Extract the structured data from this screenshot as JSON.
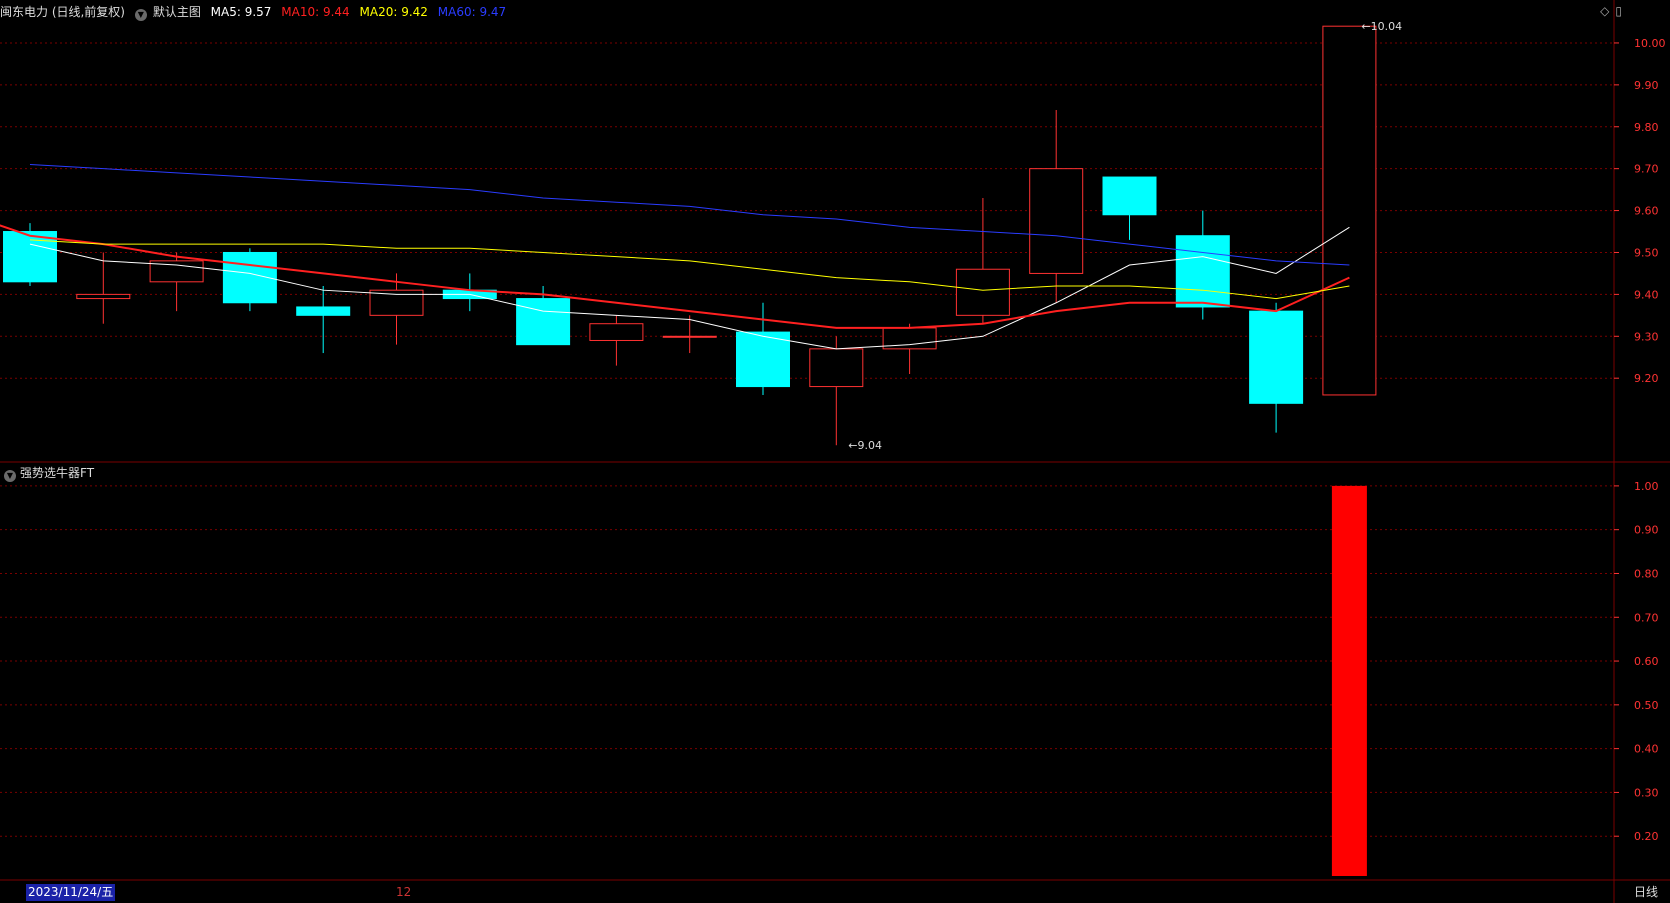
{
  "header": {
    "stock_title": "闽东电力 (日线,前复权)",
    "main_chart_name": "默认主图",
    "ma5": {
      "label": "MA5: 9.57",
      "color": "#ffffff"
    },
    "ma10": {
      "label": "MA10: 9.44",
      "color": "#ff2020"
    },
    "ma20": {
      "label": "MA20: 9.42",
      "color": "#ffff00"
    },
    "ma60": {
      "label": "MA60: 9.47",
      "color": "#2a3cff"
    }
  },
  "indicator": {
    "name": "强势选牛器FT"
  },
  "footer": {
    "date": "2023/11/24/五",
    "month_marker": "12",
    "period": "日线"
  },
  "colors": {
    "up": "#ff3232",
    "down": "#00ffff",
    "grid": "#7a0000",
    "axis_text": "#ff3333",
    "bar": "#ff0000"
  },
  "chart_data": [
    {
      "type": "candlestick",
      "ylim": [
        9.0,
        10.05
      ],
      "y_ticks": [
        "10.00",
        "9.90",
        "9.80",
        "9.70",
        "9.60",
        "9.50",
        "9.40",
        "9.30",
        "9.20"
      ],
      "y_tick_values": [
        10.0,
        9.9,
        9.8,
        9.7,
        9.6,
        9.5,
        9.4,
        9.3,
        9.2
      ],
      "candles": [
        {
          "o": 9.55,
          "h": 9.57,
          "l": 9.42,
          "c": 9.43
        },
        {
          "o": 9.39,
          "h": 9.5,
          "l": 9.33,
          "c": 9.4
        },
        {
          "o": 9.43,
          "h": 9.5,
          "l": 9.36,
          "c": 9.48
        },
        {
          "o": 9.5,
          "h": 9.51,
          "l": 9.36,
          "c": 9.38
        },
        {
          "o": 9.37,
          "h": 9.42,
          "l": 9.26,
          "c": 9.35
        },
        {
          "o": 9.35,
          "h": 9.45,
          "l": 9.28,
          "c": 9.41
        },
        {
          "o": 9.41,
          "h": 9.45,
          "l": 9.36,
          "c": 9.39
        },
        {
          "o": 9.39,
          "h": 9.42,
          "l": 9.28,
          "c": 9.28
        },
        {
          "o": 9.29,
          "h": 9.35,
          "l": 9.23,
          "c": 9.33
        },
        {
          "o": 9.3,
          "h": 9.35,
          "l": 9.26,
          "c": 9.3
        },
        {
          "o": 9.31,
          "h": 9.38,
          "l": 9.16,
          "c": 9.18
        },
        {
          "o": 9.18,
          "h": 9.3,
          "l": 9.04,
          "c": 9.27
        },
        {
          "o": 9.27,
          "h": 9.33,
          "l": 9.21,
          "c": 9.32
        },
        {
          "o": 9.35,
          "h": 9.63,
          "l": 9.33,
          "c": 9.46
        },
        {
          "o": 9.45,
          "h": 9.84,
          "l": 9.38,
          "c": 9.7
        },
        {
          "o": 9.68,
          "h": 9.68,
          "l": 9.53,
          "c": 9.59
        },
        {
          "o": 9.54,
          "h": 9.6,
          "l": 9.34,
          "c": 9.37
        },
        {
          "o": 9.36,
          "h": 9.38,
          "l": 9.07,
          "c": 9.14
        },
        {
          "o": 9.16,
          "h": 10.04,
          "l": 9.16,
          "c": 10.04
        }
      ],
      "ma_series": [
        {
          "name": "MA5",
          "color": "#ffffff",
          "width": 1,
          "values": [
            9.52,
            9.48,
            9.47,
            9.45,
            9.41,
            9.4,
            9.4,
            9.36,
            9.35,
            9.34,
            9.3,
            9.27,
            9.28,
            9.3,
            9.38,
            9.47,
            9.49,
            9.45,
            9.56
          ]
        },
        {
          "name": "MA10",
          "color": "#ff2020",
          "width": 2,
          "values": [
            9.57,
            9.54,
            9.52,
            9.49,
            9.47,
            9.45,
            9.43,
            9.41,
            9.4,
            9.38,
            9.36,
            9.34,
            9.32,
            9.32,
            9.33,
            9.36,
            9.38,
            9.38,
            9.36,
            9.44
          ]
        },
        {
          "name": "MA20",
          "color": "#ffff00",
          "width": 1,
          "values": [
            9.53,
            9.52,
            9.52,
            9.52,
            9.52,
            9.51,
            9.51,
            9.5,
            9.49,
            9.48,
            9.46,
            9.44,
            9.43,
            9.41,
            9.42,
            9.42,
            9.41,
            9.39,
            9.42
          ]
        },
        {
          "name": "MA60",
          "color": "#2a3cff",
          "width": 1,
          "values": [
            9.71,
            9.7,
            9.69,
            9.68,
            9.67,
            9.66,
            9.65,
            9.63,
            9.62,
            9.61,
            9.59,
            9.58,
            9.56,
            9.55,
            9.54,
            9.52,
            9.5,
            9.48,
            9.47
          ]
        }
      ],
      "annotations": [
        {
          "label": "10.04",
          "index": 18,
          "value": 10.04
        },
        {
          "label": "9.04",
          "index": 11,
          "value": 9.04
        }
      ]
    },
    {
      "type": "bar",
      "ylim": [
        0.1,
        1.05
      ],
      "y_ticks": [
        "1.00",
        "0.90",
        "0.80",
        "0.70",
        "0.60",
        "0.50",
        "0.40",
        "0.30",
        "0.20"
      ],
      "y_tick_values": [
        1.0,
        0.9,
        0.8,
        0.7,
        0.6,
        0.5,
        0.4,
        0.3,
        0.2
      ],
      "values": [
        0,
        0,
        0,
        0,
        0,
        0,
        0,
        0,
        0,
        0,
        0,
        0,
        0,
        0,
        0,
        0,
        0,
        0,
        1.0
      ]
    }
  ]
}
